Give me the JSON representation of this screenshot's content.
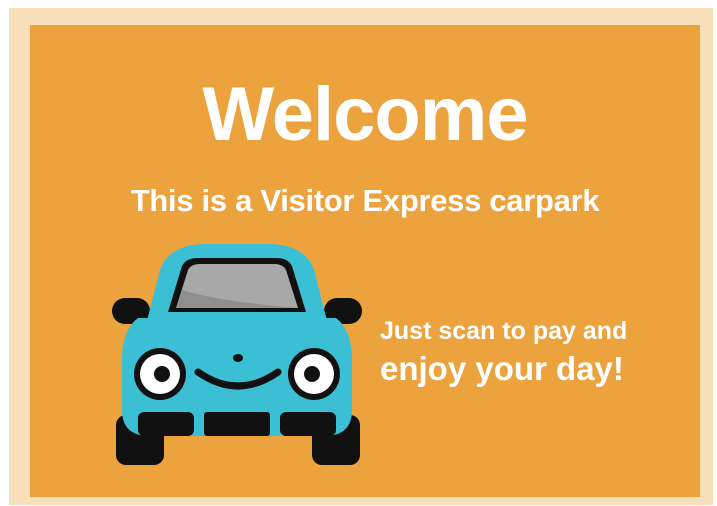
{
  "sign": {
    "headline": "Welcome",
    "subheadline": "This is a Visitor Express carpark",
    "tagline_line1": "Just scan to pay and",
    "tagline_line2": "enjoy your day!",
    "illustration": "smiling-car-illustration"
  },
  "colors": {
    "frame": "#f7dfba",
    "panel": "#eca33e",
    "text": "#ffffff",
    "car_body": "#3bbfd5",
    "car_dark": "#111111",
    "windshield": "#a8a8a8"
  }
}
